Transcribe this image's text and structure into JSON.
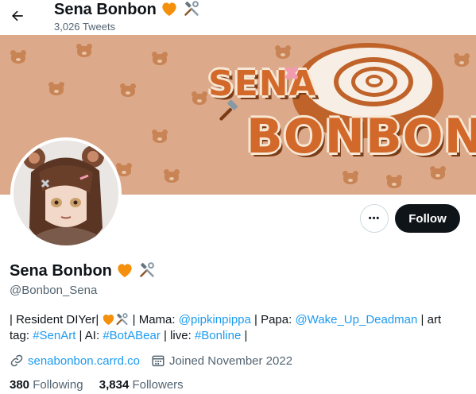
{
  "header": {
    "title": "Sena Bonbon",
    "tweets_count": "3,026 Tweets"
  },
  "banner": {
    "logo_line1": "SENA",
    "logo_line2": "BONBON"
  },
  "actions": {
    "more_label": "•••",
    "follow_label": "Follow"
  },
  "profile": {
    "name": "Sena Bonbon",
    "handle": "@Bonbon_Sena",
    "name_emojis": [
      "orange-heart-icon",
      "hammer-wrench-icon"
    ],
    "bio": {
      "p1": "| Resident DIYer| ",
      "p2": " | Mama: ",
      "mama": "@pipkinpippa",
      "p3": " | Papa: ",
      "papa": "@Wake_Up_Deadman",
      "p4": " | art tag: ",
      "art_tag": "#SenArt",
      "p5": " | AI: ",
      "ai_tag": "#BotABear",
      "p6": " | live: ",
      "live_tag": "#Bonline",
      "p7": " |"
    },
    "website": "senabonbon.carrd.co",
    "joined": "Joined November 2022",
    "following_count": "380",
    "following_label": "Following",
    "followers_count": "3,834",
    "followers_label": "Followers"
  },
  "colors": {
    "accent_link": "#1d9bf0",
    "banner_bg": "#dcaa8b",
    "logo_orange": "#d2692b",
    "follow_bg": "#0f1419"
  }
}
